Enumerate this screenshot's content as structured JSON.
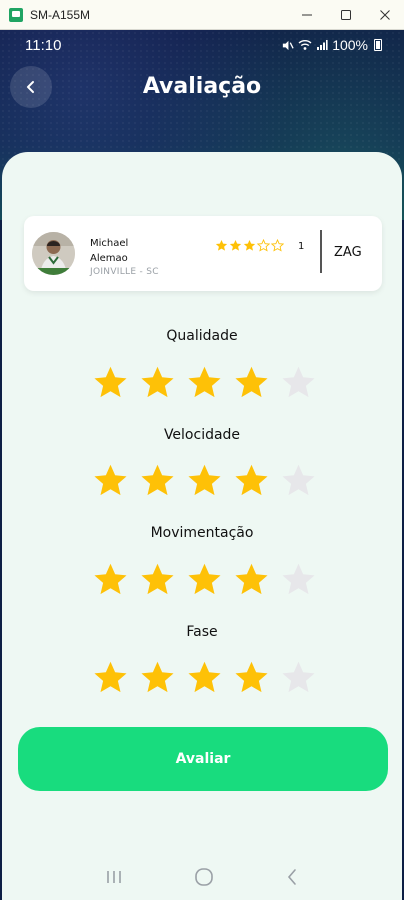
{
  "window": {
    "title": "SM-A155M"
  },
  "status_bar": {
    "time": "11:10",
    "battery": "100%"
  },
  "header": {
    "title": "Avaliação"
  },
  "player": {
    "name_line1": "Michael",
    "name_line2": "Alemao",
    "city": "JOINVILLE - SC",
    "rating": 3,
    "rating_max": 5,
    "rating_count": "1",
    "position": "ZAG"
  },
  "criteria": [
    {
      "label": "Qualidade",
      "value": 4,
      "max": 5
    },
    {
      "label": "Velocidade",
      "value": 4,
      "max": 5
    },
    {
      "label": "Movimentação",
      "value": 4,
      "max": 5
    },
    {
      "label": "Fase",
      "value": 4,
      "max": 5
    }
  ],
  "submit": {
    "label": "Avaliar"
  },
  "colors": {
    "star_filled": "#fec107",
    "star_empty": "#e7e7ea",
    "accent": "#18dc7e",
    "header_bg": "#0f1d46",
    "sheet_bg": "#eef8f3"
  }
}
